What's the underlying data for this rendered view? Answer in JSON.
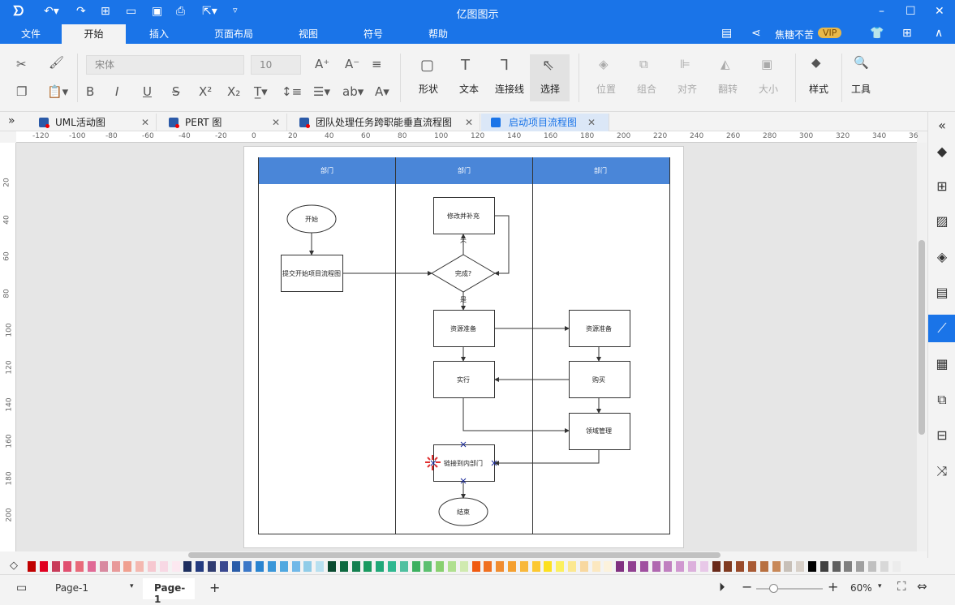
{
  "app": {
    "title": "亿图图示"
  },
  "quick_access": [
    "logo-icon",
    "undo-icon",
    "redo-icon",
    "new-icon",
    "open-icon",
    "save-icon",
    "print-icon",
    "export-icon",
    "customize-icon"
  ],
  "menu": {
    "items": [
      "文件",
      "开始",
      "插入",
      "页面布局",
      "视图",
      "符号",
      "帮助"
    ],
    "active": "开始",
    "user": "焦糖不苦",
    "vip": "VIP"
  },
  "ribbon": {
    "font": "宋体",
    "size": "10",
    "shape": "形状",
    "text": "文本",
    "connector": "连接线",
    "select": "选择",
    "position": "位置",
    "group": "组合",
    "align": "对齐",
    "flip": "翻转",
    "size_label": "大小",
    "style": "样式",
    "tools": "工具"
  },
  "tabs": [
    {
      "label": "UML活动图"
    },
    {
      "label": "PERT 图"
    },
    {
      "label": "团队处理任务跨职能垂直流程图"
    },
    {
      "label": "启动项目流程图",
      "active": true
    }
  ],
  "ruler_top": [
    "-120",
    "-100",
    "-80",
    "-60",
    "-40",
    "-20",
    "0",
    "20",
    "40",
    "60",
    "80",
    "100",
    "120",
    "140",
    "160",
    "180",
    "200",
    "220",
    "240",
    "260",
    "280",
    "300",
    "320",
    "340",
    "36"
  ],
  "ruler_left": [
    "20",
    "40",
    "60",
    "80",
    "100",
    "120",
    "140",
    "160",
    "180",
    "200"
  ],
  "diagram": {
    "lanes": [
      "部门",
      "部门",
      "部门"
    ],
    "start": "开始",
    "submit": "提交开始项目流程图",
    "revise": "修改并补充",
    "decision": "完成?",
    "no": "不",
    "yes": "是",
    "res1": "资源准备",
    "res2": "资源准备",
    "execute": "实行",
    "purchase": "购买",
    "domain": "领域管理",
    "link": "链接到内部门",
    "end": "结束"
  },
  "colors": {
    "accent": "#1a74e8",
    "lane_header": "#4a86d8"
  },
  "palette": [
    "#c00000",
    "#e00020",
    "#c83c5a",
    "#e05070",
    "#e86a7a",
    "#e06a96",
    "#d88aa0",
    "#e89a9a",
    "#f0a090",
    "#f4b8b0",
    "#f6c8d0",
    "#f8d8e4",
    "#fce8f0",
    "#1e3060",
    "#243c80",
    "#303c70",
    "#3a4890",
    "#2a5ca8",
    "#3c78c8",
    "#2a84d0",
    "#3a96d8",
    "#50a8e0",
    "#70b8e8",
    "#90cce8",
    "#b8e0f0",
    "#0a4a30",
    "#0e6a40",
    "#148050",
    "#1a9a60",
    "#20a878",
    "#30b890",
    "#50c0a0",
    "#3cb060",
    "#5cc070",
    "#88d070",
    "#b0e090",
    "#d0eab0",
    "#f05a10",
    "#f07020",
    "#f08c30",
    "#f4a030",
    "#f8b83c",
    "#fcc830",
    "#fce020",
    "#fcf060",
    "#fce890",
    "#f8d8a0",
    "#fce8c0",
    "#fcf2dc",
    "#803080",
    "#904090",
    "#a050a0",
    "#b068b0",
    "#c080c0",
    "#d098d0",
    "#dcb0dc",
    "#e8c8e8",
    "#6a2a1a",
    "#803a20",
    "#984a2a",
    "#a85a34",
    "#b87040",
    "#c88858",
    "#c8c0b8",
    "#d8d0c8",
    "#000000",
    "#404040",
    "#606060",
    "#808080",
    "#a0a0a0",
    "#c0c0c0",
    "#d8d8d8",
    "#ececec"
  ],
  "status": {
    "page_select": "Page-1",
    "page_tab": "Page-1",
    "add": "+",
    "zoom": "60%",
    "zoom_fraction": 0.25
  }
}
